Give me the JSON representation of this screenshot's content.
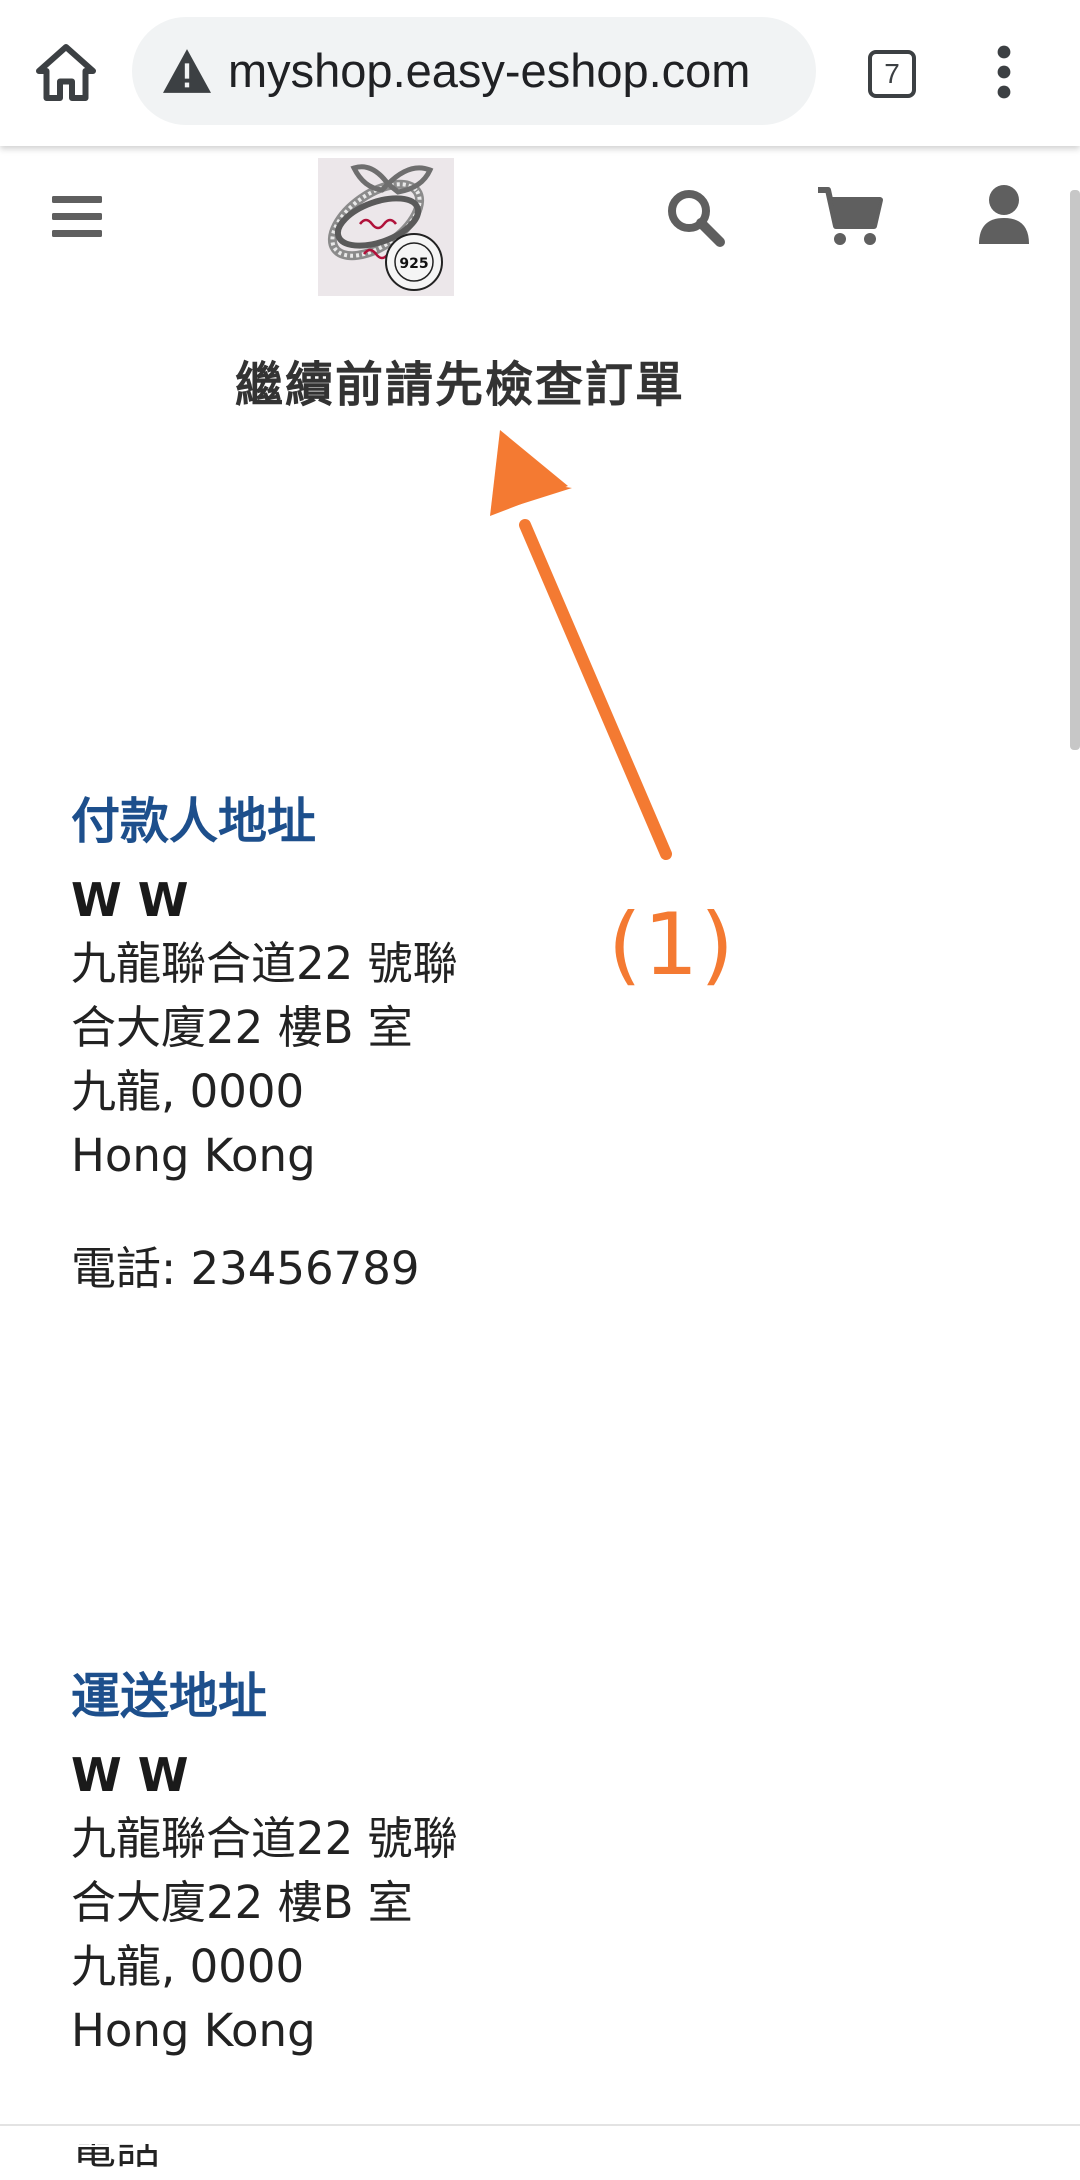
{
  "browser": {
    "url": "myshop.easy-eshop.com",
    "tab_count": "7",
    "icons": {
      "home": "home-icon",
      "security": "warning-triangle-icon",
      "tabs": "tab-switcher-icon",
      "menu": "more-vert-icon"
    }
  },
  "header": {
    "logo_alt": "Wong Shop 925 Real Sterling Silver",
    "icons": {
      "menu": "hamburger-icon",
      "search": "search-icon",
      "cart": "cart-icon",
      "account": "user-icon"
    }
  },
  "page": {
    "title": "繼續前請先檢查訂單"
  },
  "annotation": {
    "label": "(1)",
    "color": "#f47a32"
  },
  "billing": {
    "heading": "付款人地址",
    "name": "W W",
    "lines": [
      "九龍聯合道22 號聯",
      "合大廈22 樓B 室",
      "九龍, 0000",
      "Hong Kong"
    ],
    "phone": "電話: 23456789"
  },
  "shipping": {
    "heading": "運送地址",
    "name": "W W",
    "lines": [
      "九龍聯合道22 號聯",
      "合大廈22 樓B 室",
      "九龍, 0000",
      "Hong Kong"
    ],
    "phone_partial": "電話"
  },
  "colors": {
    "heading_blue": "#1d4f8c",
    "annotation_orange": "#f47a32",
    "icon_gray": "#5f5f5f"
  }
}
